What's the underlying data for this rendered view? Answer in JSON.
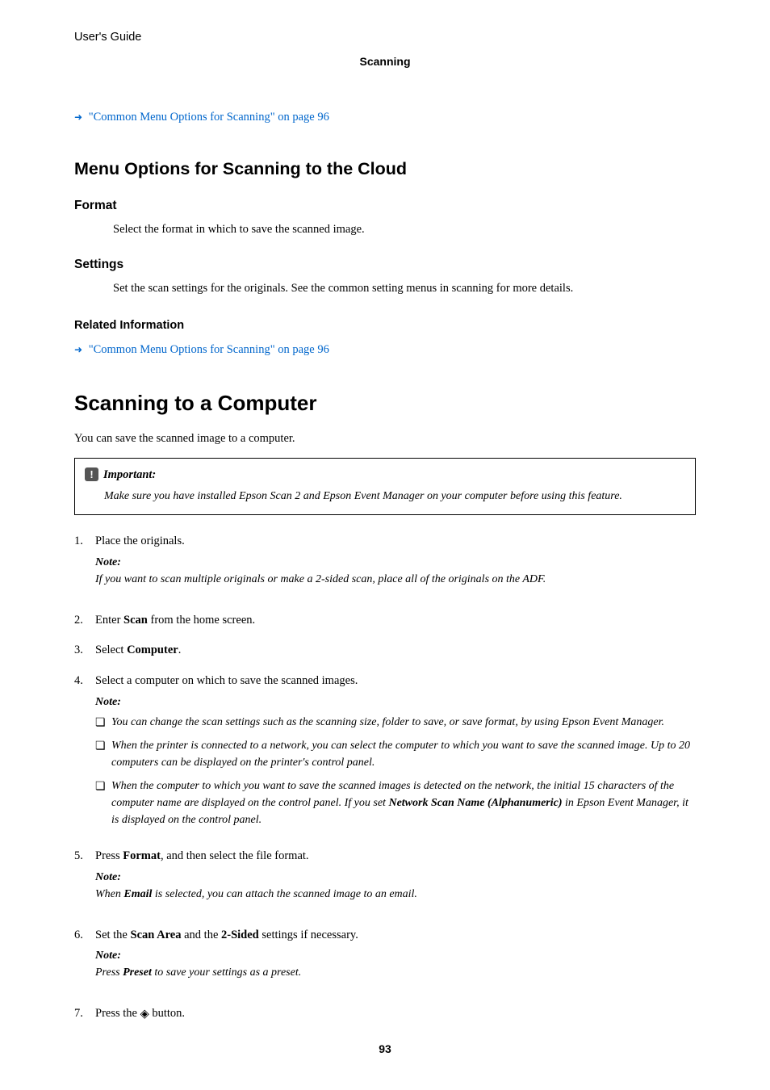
{
  "header": {
    "title": "User's Guide",
    "section": "Scanning"
  },
  "links": {
    "common_menu": "\"Common Menu Options for Scanning\" on page 96"
  },
  "cloud": {
    "heading": "Menu Options for Scanning to the Cloud",
    "format_h": "Format",
    "format_b": "Select the format in which to save the scanned image.",
    "settings_h": "Settings",
    "settings_b": "Set the scan settings for the originals. See the common setting menus in scanning for more details.",
    "related": "Related Information"
  },
  "comp": {
    "heading": "Scanning to a Computer",
    "intro": "You can save the scanned image to a computer.",
    "important_label": "Important:",
    "important_body": "Make sure you have installed Epson Scan 2 and Epson Event Manager on your computer before using this feature.",
    "s1": "Place the originals.",
    "s1_note": "If you want to scan multiple originals or make a 2-sided scan, place all of the originals on the ADF.",
    "s2a": "Enter ",
    "s2b": "Scan",
    "s2c": " from the home screen.",
    "s3a": "Select ",
    "s3b": "Computer",
    "s3c": ".",
    "s4": "Select a computer on which to save the scanned images.",
    "s4_b1": "You can change the scan settings such as the scanning size, folder to save, or save format, by using Epson Event Manager.",
    "s4_b2": "When the printer is connected to a network, you can select the computer to which you want to save the scanned image. Up to 20 computers can be displayed on the printer's control panel.",
    "s4_b3a": "When the computer to which you want to save the scanned images is detected on the network, the initial 15 characters of the computer name are displayed on the control panel. If you set ",
    "s4_b3b": "Network Scan Name (Alphanumeric)",
    "s4_b3c": " in Epson Event Manager, it is displayed on the control panel.",
    "s5a": "Press ",
    "s5b": "Format",
    "s5c": ", and then select the file format.",
    "s5_note_a": "When ",
    "s5_note_b": "Email",
    "s5_note_c": " is selected, you can attach the scanned image to an email.",
    "s6a": "Set the ",
    "s6b": "Scan Area",
    "s6c": " and the ",
    "s6d": "2-Sided",
    "s6e": " settings if necessary.",
    "s6_note_a": "Press ",
    "s6_note_b": "Preset",
    "s6_note_c": " to save your settings as a preset.",
    "s7a": "Press the ",
    "s7b": " button.",
    "note_label": "Note:"
  },
  "page": "93"
}
